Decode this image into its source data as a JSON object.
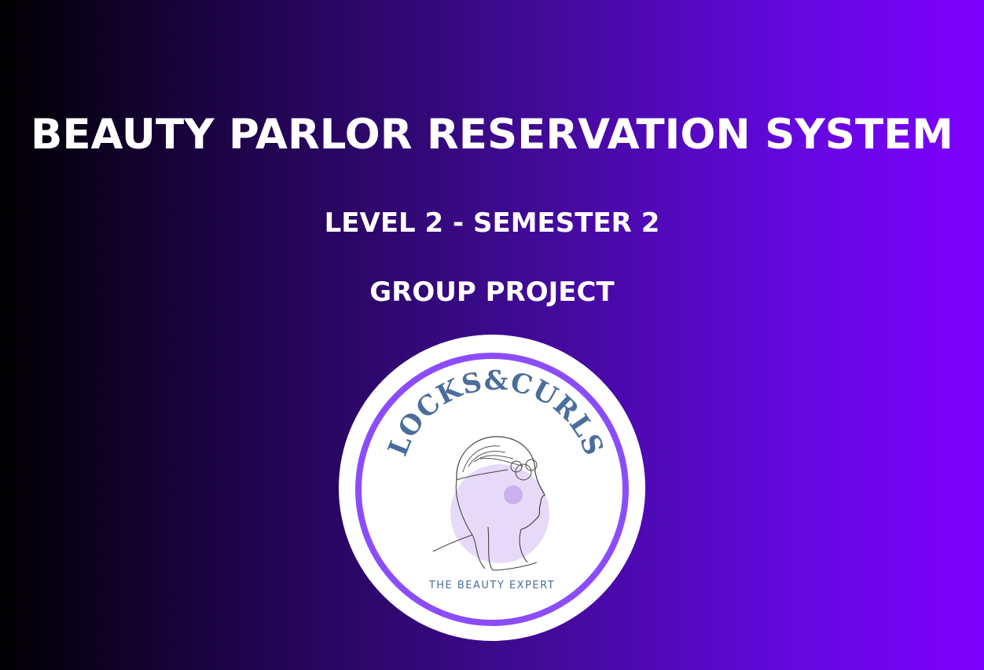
{
  "slide": {
    "title": "BEAUTY PARLOR RESERVATION SYSTEM",
    "subtitle": "LEVEL 2 - SEMESTER 2",
    "project_type": "GROUP PROJECT"
  },
  "logo": {
    "brand_text": "LOCKS&CURLS",
    "tagline": "THE BEAUTY EXPERT",
    "icon": "woman-profile-with-flower-crown-icon"
  },
  "colors": {
    "gradient_start": "#000000",
    "gradient_end": "#7f00ff",
    "logo_ring": "#8b4dfc",
    "logo_text": "#4a6d9c",
    "logo_accent": "#d9c8f5"
  }
}
